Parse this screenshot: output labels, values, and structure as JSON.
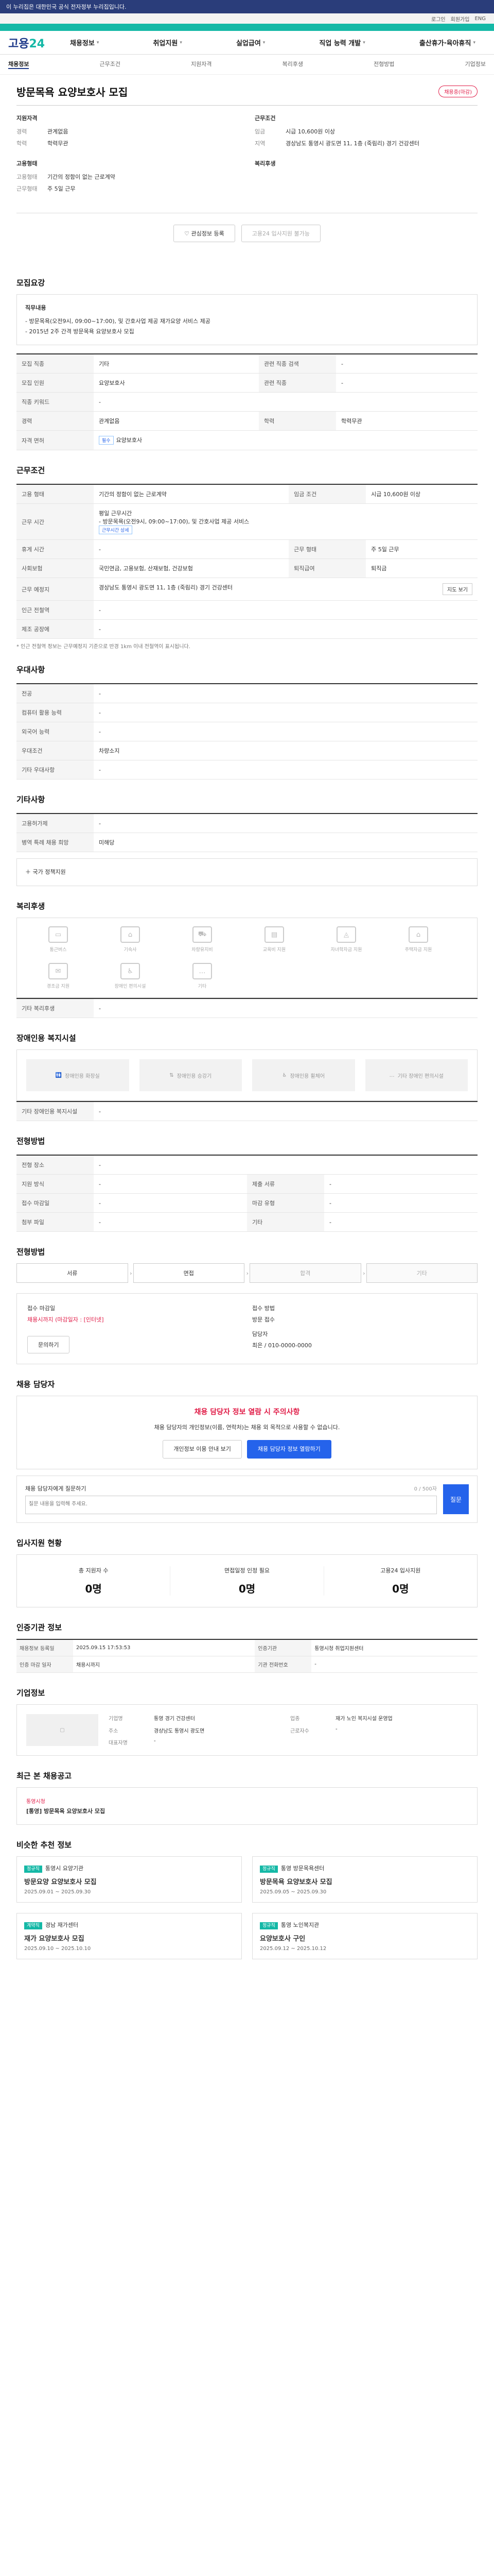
{
  "topbar": {
    "notice": "이 누리집은 대한민국 공식 전자정부 누리집입니다."
  },
  "util": [
    "로그인",
    "회원가입",
    "ENG"
  ],
  "logo": {
    "main": "고용",
    "accent": "24"
  },
  "menu": [
    "채용정보",
    "취업지원",
    "실업급여",
    "직업 능력 개발",
    "출산휴가·육아휴직"
  ],
  "tabs": [
    "채용정보",
    "근무조건",
    "지원자격",
    "복리후생",
    "전형방법",
    "기업정보"
  ],
  "job": {
    "title": "방문목욕 요양보호사 모집",
    "status": "채용중(마감)"
  },
  "summary": {
    "left_title": "지원자격",
    "left": [
      {
        "k": "경력",
        "v": "관계없음"
      },
      {
        "k": "학력",
        "v": "학력무관"
      }
    ],
    "right_title": "근무조건",
    "right": [
      {
        "k": "임금",
        "v": "시급 10,600원 이상"
      },
      {
        "k": "지역",
        "v": "경상남도 통영시 광도면 11, 1층 (죽림리) 경기 건강센터"
      }
    ],
    "left2_title": "고용형태",
    "left2": [
      {
        "k": "고용형태",
        "v": "기간의 정함이 없는 근로계약"
      },
      {
        "k": "근무형태",
        "v": "주 5일 근무"
      }
    ],
    "right2_title": "복리후생",
    "right2": []
  },
  "buttons": {
    "interest": "관심정보 등록",
    "apply": "고용24 입사지원 불가능"
  },
  "detail": {
    "title": "모집요강",
    "duty_title": "직무내용",
    "duty": [
      "- 방문목욕(오전9시, 09:00~17:00), 및 간호사업 제공 재가요양 서비스 제공",
      "- 2015년 2주 간격 방문목욕 요양보호사 모집"
    ],
    "rows": [
      {
        "k": "모집 직종",
        "v": "기타",
        "k2": "관련 직종 검색",
        "v2": "-"
      },
      {
        "k": "모집 인원",
        "v": "요양보호사",
        "k2": "관련 직종",
        "v2": "-"
      },
      {
        "k": "직종 키워드",
        "v": "-",
        "k2": "",
        "v2": ""
      },
      {
        "k": "경력",
        "v": "관계없음",
        "k2": "학력",
        "v2": "학력무관"
      }
    ],
    "license_k": "자격 면허",
    "license": [
      "필수",
      "요양보호사"
    ]
  },
  "work": {
    "title": "근무조건",
    "type_k": "고용 형태",
    "type_v": "기간의 정함이 없는 근로계약",
    "wage_k": "임금 조건",
    "wage_v": "시급 10,600원 이상",
    "time_k": "근무 시간",
    "time_lines": [
      "평일 근무시간",
      "- 방문목욕(오전9시, 09:00~17:00), 및 간호사업 제공 서비스",
      "근무시간 상세"
    ],
    "hours_k": "휴게 시간",
    "hours_v": "-",
    "days_k": "근무 형태",
    "days_v": "주 5일 근무",
    "ins_k": "사회보험",
    "ins_v": "국민연금, 고용보험, 산재보험, 건강보험",
    "retire_k": "퇴직급여",
    "retire_v": "퇴직금",
    "place_k": "근무 예정지",
    "place_v": "경상남도 통영시 광도면 11, 1층 (죽림리) 경기 건강센터",
    "place_btn": "지도 보기",
    "etc": [
      {
        "k": "인근 전철역",
        "v": "-"
      },
      {
        "k": "제조 공장에",
        "v": "-"
      }
    ],
    "note": "* 인근 전철역 정보는 근무예정지 기준으로 반경 1km 이내 전철역이 표시됩니다."
  },
  "qual": {
    "title": "우대사항",
    "rows": [
      {
        "k": "전공",
        "v": "-"
      },
      {
        "k": "컴퓨터 활용 능력",
        "v": "-"
      },
      {
        "k": "외국어 능력",
        "v": "-"
      },
      {
        "k": "우대조건",
        "v": "차량소지"
      },
      {
        "k": "기타 우대사항",
        "v": "-"
      }
    ]
  },
  "etc": {
    "title": "기타사항",
    "rows": [
      {
        "k": "고용허가제",
        "v": "-"
      },
      {
        "k": "병역 특례 채용 희망",
        "v": "미해당"
      }
    ],
    "link": "국가 정책지원"
  },
  "welfare": {
    "title": "복리후생",
    "items": [
      "통근버스",
      "기숙사",
      "차량유지비",
      "교육비 지원",
      "자녀학자금 지원",
      "주택자금 지원",
      "경조금 지원",
      "장애인 편의시설",
      "기타"
    ],
    "etc_k": "기타 복리후생",
    "etc_v": "-"
  },
  "fac": {
    "title": "장애인용 복지시설",
    "items": [
      "장애인용 화장실",
      "장애인용 승강기",
      "장애인용 휠체어",
      "기타 장애인 편의시설"
    ],
    "note_k": "기타 장애인용 복지시설",
    "note_v": "-"
  },
  "method": {
    "title": "전형방법",
    "rows": [
      {
        "k": "전형 장소",
        "v": "-",
        "k2": "",
        "v2": ""
      },
      {
        "k": "지원 방식",
        "v": "-",
        "k2": "제출 서류",
        "v2": "-"
      },
      {
        "k": "접수 마감일",
        "v": "-",
        "k2": "마감 유형",
        "v2": "-"
      },
      {
        "k": "첨부 파일",
        "v": "-",
        "k2": "기타",
        "v2": "-"
      }
    ]
  },
  "steps": {
    "title": "전형방법",
    "items": [
      "서류",
      "면접",
      "합격",
      "기타"
    ]
  },
  "apply": {
    "label": "접수 마감일",
    "deadline": "채용시까지 (마감일자 : [인터넷]",
    "method_k": "접수 방법",
    "method": "방문 접수",
    "contact_k": "담당자",
    "contact": "최은 / 010-0000-0000",
    "btn": "문의하기"
  },
  "manager": {
    "title": "채용 담당자",
    "red": "채용 담당자 정보 열람 시 주의사항",
    "text": "채용 담당자의 개인정보(이름, 연락처)는 채용 외 목적으로 사용할 수 없습니다.",
    "btn1": "개인정보 이용 안내 보기",
    "btn2": "채용 담당자 정보 열람하기"
  },
  "qa": {
    "title": "채용 담당자에게 질문하기",
    "placeholder": "질문 내용을 입력해 주세요.",
    "submit": "질문",
    "count": "0 / 500자"
  },
  "stats": {
    "title": "입사지원 현황",
    "items": [
      {
        "k": "총 지원자 수",
        "v": "0명"
      },
      {
        "k": "면접일정 인정 필요",
        "v": "0명"
      },
      {
        "k": "고용24 입사지원",
        "v": "0명"
      }
    ]
  },
  "info": {
    "title": "인증기관 정보",
    "rows": [
      {
        "k": "채용정보 등록일",
        "v": "2025.09.15 17:53:53",
        "k2": "인증기관",
        "v2": "통영시청 취업지원센터"
      },
      {
        "k": "인증 마감 일자",
        "v": "채용시까지",
        "k2": "기관 전화번호",
        "v2": "-"
      }
    ]
  },
  "corp": {
    "title": "기업정보",
    "labels": [
      "기업명",
      "업종",
      "주소",
      "근로자수",
      "대표자명"
    ],
    "values": [
      "통영 경기 건강센터",
      "재가 노인 복지시설 운영업",
      "경상남도 통영시 광도면",
      "-",
      "-"
    ]
  },
  "recent": {
    "title": "최근 본 채용공고",
    "item": "[통영] 방문목욕 요양보호사 모집",
    "org": "통영시청"
  },
  "cards": {
    "title": "비슷한 추천 정보",
    "items": [
      {
        "tag": "정규직",
        "org": "통영시 요양기관",
        "title": "방문요양 요양보호사 모집",
        "meta": "2025.09.01 ~ 2025.09.30"
      },
      {
        "tag": "정규직",
        "org": "통영 방문목욕센터",
        "title": "방문목욕 요양보호사 모집",
        "meta": "2025.09.05 ~ 2025.09.30"
      },
      {
        "tag": "계약직",
        "org": "경남 재가센터",
        "title": "재가 요양보호사 모집",
        "meta": "2025.09.10 ~ 2025.10.10"
      },
      {
        "tag": "정규직",
        "org": "통영 노인복지관",
        "title": "요양보호사 구인",
        "meta": "2025.09.12 ~ 2025.10.12"
      }
    ]
  }
}
